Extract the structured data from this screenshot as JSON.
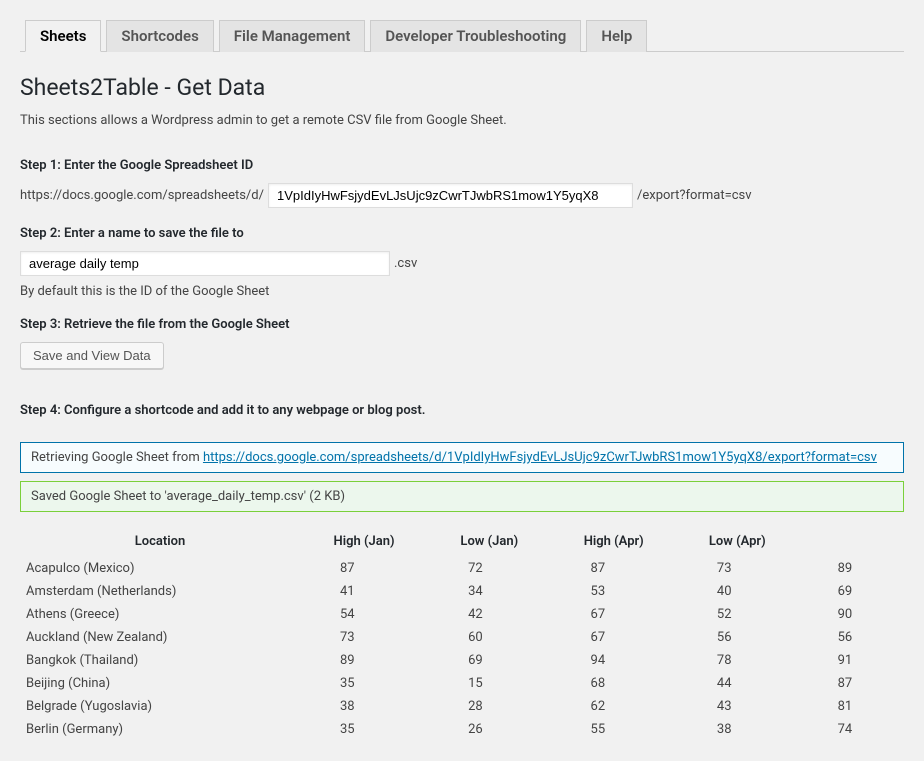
{
  "tabs": [
    {
      "label": "Sheets",
      "active": true
    },
    {
      "label": "Shortcodes",
      "active": false
    },
    {
      "label": "File Management",
      "active": false
    },
    {
      "label": "Developer Troubleshooting",
      "active": false
    },
    {
      "label": "Help",
      "active": false
    }
  ],
  "page_title": "Sheets2Table - Get Data",
  "description": "This sections allows a Wordpress admin to get a remote CSV file from Google Sheet.",
  "step1": {
    "label": "Step 1: Enter the Google Spreadsheet ID",
    "prefix": "https://docs.google.com/spreadsheets/d/",
    "value": "1VpIdIyHwFsjydEvLJsUjc9zCwrTJwbRS1mow1Y5yqX8",
    "suffix": "/export?format=csv"
  },
  "step2": {
    "label": "Step 2: Enter a name to save the file to",
    "value": "average daily temp",
    "suffix": ".csv",
    "hint": "By default this is the ID of the Google Sheet"
  },
  "step3": {
    "label": "Step 3: Retrieve the file from the Google Sheet",
    "button": "Save and View Data"
  },
  "step4": {
    "label": "Step 4: Configure a shortcode and add it to any webpage or blog post."
  },
  "notice_info_prefix": "Retrieving Google Sheet from ",
  "notice_info_link": "https://docs.google.com/spreadsheets/d/1VpIdIyHwFsjydEvLJsUjc9zCwrTJwbRS1mow1Y5yqX8/export?format=csv",
  "notice_success": "Saved Google Sheet to 'average_daily_temp.csv' (2 KB)",
  "table": {
    "headers": [
      "Location",
      "High (Jan)",
      "Low (Jan)",
      "High (Apr)",
      "Low (Apr)",
      ""
    ],
    "rows": [
      [
        "Acapulco (Mexico)",
        "87",
        "72",
        "87",
        "73",
        "89"
      ],
      [
        "Amsterdam (Netherlands)",
        "41",
        "34",
        "53",
        "40",
        "69"
      ],
      [
        "Athens (Greece)",
        "54",
        "42",
        "67",
        "52",
        "90"
      ],
      [
        "Auckland (New Zealand)",
        "73",
        "60",
        "67",
        "56",
        "56"
      ],
      [
        "Bangkok (Thailand)",
        "89",
        "69",
        "94",
        "78",
        "91"
      ],
      [
        "Beijing (China)",
        "35",
        "15",
        "68",
        "44",
        "87"
      ],
      [
        "Belgrade (Yugoslavia)",
        "38",
        "28",
        "62",
        "43",
        "81"
      ],
      [
        "Berlin (Germany)",
        "35",
        "26",
        "55",
        "38",
        "74"
      ]
    ]
  }
}
